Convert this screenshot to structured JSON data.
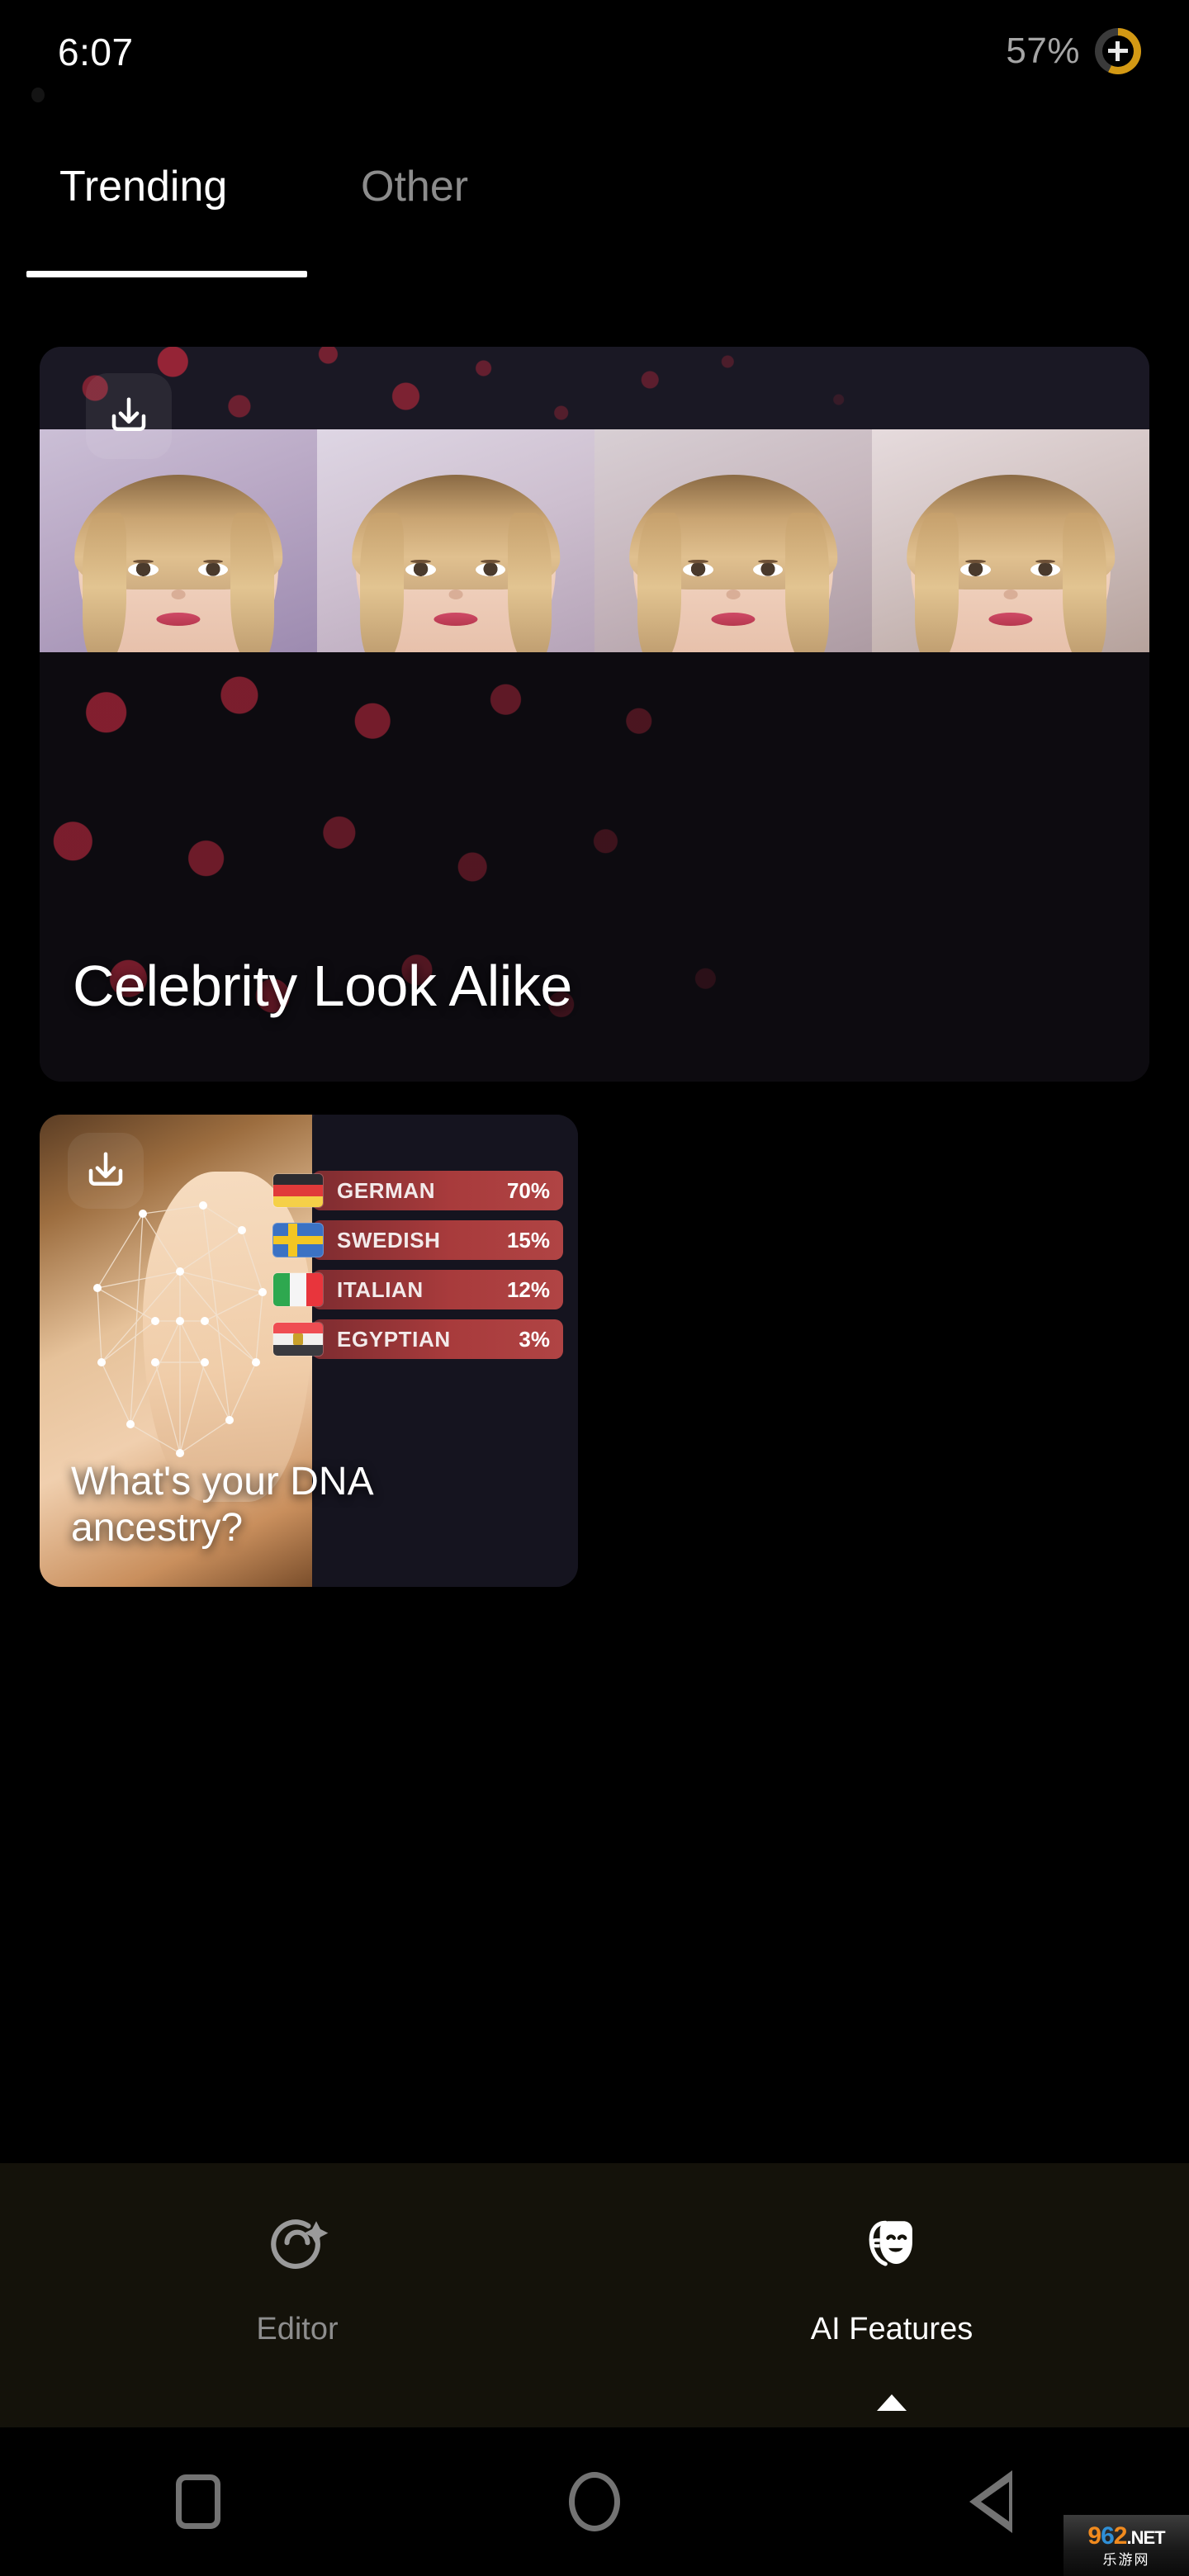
{
  "status_bar": {
    "time": "6:07",
    "battery_percent": "57%",
    "battery_level": 57,
    "battery_icon": "battery-charging-plus-icon",
    "camera_icon": "punch-hole-camera"
  },
  "tabs": {
    "items": [
      {
        "label": "Trending",
        "active": true
      },
      {
        "label": "Other",
        "active": false
      }
    ]
  },
  "cards": [
    {
      "id": "celebrity-look-alike",
      "title": "Celebrity Look Alike",
      "download_icon": "download-icon",
      "preview": "four-blonde-female-faces-morph-strip"
    },
    {
      "id": "dna-ancestry",
      "title": "What's your DNA ancestry?",
      "title_line1": "What's your DNA",
      "title_line2": "ancestry?",
      "download_icon": "download-icon",
      "preview": "female-face-with-facial-recognition-mesh"
    }
  ],
  "chart_data": {
    "type": "bar",
    "title": "What's your DNA ancestry?",
    "categories": [
      "GERMAN",
      "SWEDISH",
      "ITALIAN",
      "EGYPTIAN"
    ],
    "values": [
      70,
      15,
      12,
      3
    ],
    "value_labels": [
      "70%",
      "15%",
      "12%",
      "3%"
    ],
    "flags": [
      "german-flag",
      "swedish-flag",
      "italian-flag",
      "egyptian-flag"
    ],
    "xlabel": "",
    "ylabel": "",
    "ylim": [
      0,
      100
    ],
    "bar_color": "#a83b3c",
    "orientation": "horizontal",
    "grid": false,
    "legend": "none"
  },
  "bottom_nav": {
    "items": [
      {
        "label": "Editor",
        "icon": "face-sparkle-icon",
        "active": false
      },
      {
        "label": "AI Features",
        "icon": "theater-masks-icon",
        "active": true
      }
    ]
  },
  "android_nav": {
    "recents": "recents-square-icon",
    "home": "home-circle-icon",
    "back": "back-triangle-icon"
  },
  "watermark": {
    "digit_9": "9",
    "digit_6": "6",
    "digit_2": "2",
    "tld": ".NET",
    "chinese": "乐游网"
  },
  "colors": {
    "background": "#000000",
    "accent_red": "#a83b3c",
    "battery_gold": "#d39914",
    "nav_bar_bg": "#14120a",
    "card_bg": "#15141d"
  }
}
